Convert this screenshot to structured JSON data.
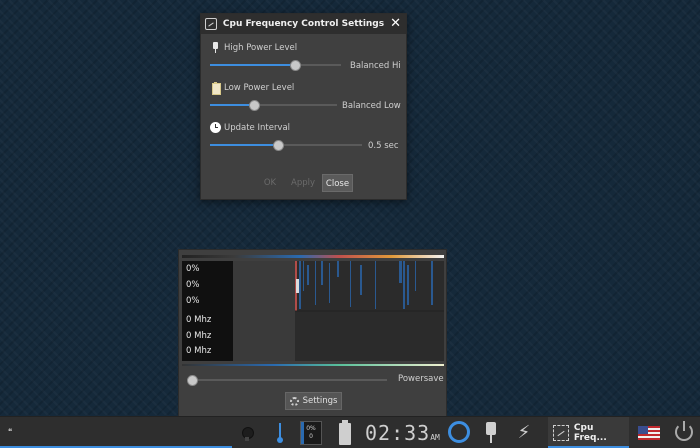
{
  "dialog": {
    "title": "Cpu Frequency Control Settings",
    "close_glyph": "✕",
    "high_power": {
      "label": "High Power Level",
      "value_label": "Balanced Hi",
      "fraction": 0.65
    },
    "low_power": {
      "label": "Low Power Level",
      "value_label": "Balanced Low",
      "fraction": 0.35
    },
    "update_interval": {
      "label": "Update Interval",
      "value_label": "0.5 sec",
      "fraction": 0.45
    },
    "buttons": {
      "ok": "OK",
      "apply": "Apply",
      "close": "Close"
    }
  },
  "cpu_popup": {
    "usage": [
      "0%",
      "0%",
      "0%"
    ],
    "freqs": [
      "0 Mhz",
      "0 Mhz",
      "0 Mhz"
    ],
    "mode_label": "Powersave",
    "mode_fraction": 0.0,
    "settings_label": "Settings"
  },
  "taskbar": {
    "start_label": "❝",
    "cpu_mini": {
      "line1": "0%",
      "line2": "0"
    },
    "clock": {
      "time": "02:33",
      "ampm": "AM"
    },
    "bolt_glyph": "⚡",
    "task_label": "Cpu Freq..."
  },
  "colors": {
    "accent": "#3d8ee0",
    "desktop": "#15293a",
    "panel": "#2e2e2e"
  },
  "icons": [
    "app-icon",
    "close-icon",
    "plug-icon",
    "battery-icon",
    "clock-icon",
    "gear-icon",
    "bulb-icon",
    "thermometer-icon",
    "ring-icon",
    "bolt-icon",
    "flag-icon",
    "power-icon"
  ]
}
